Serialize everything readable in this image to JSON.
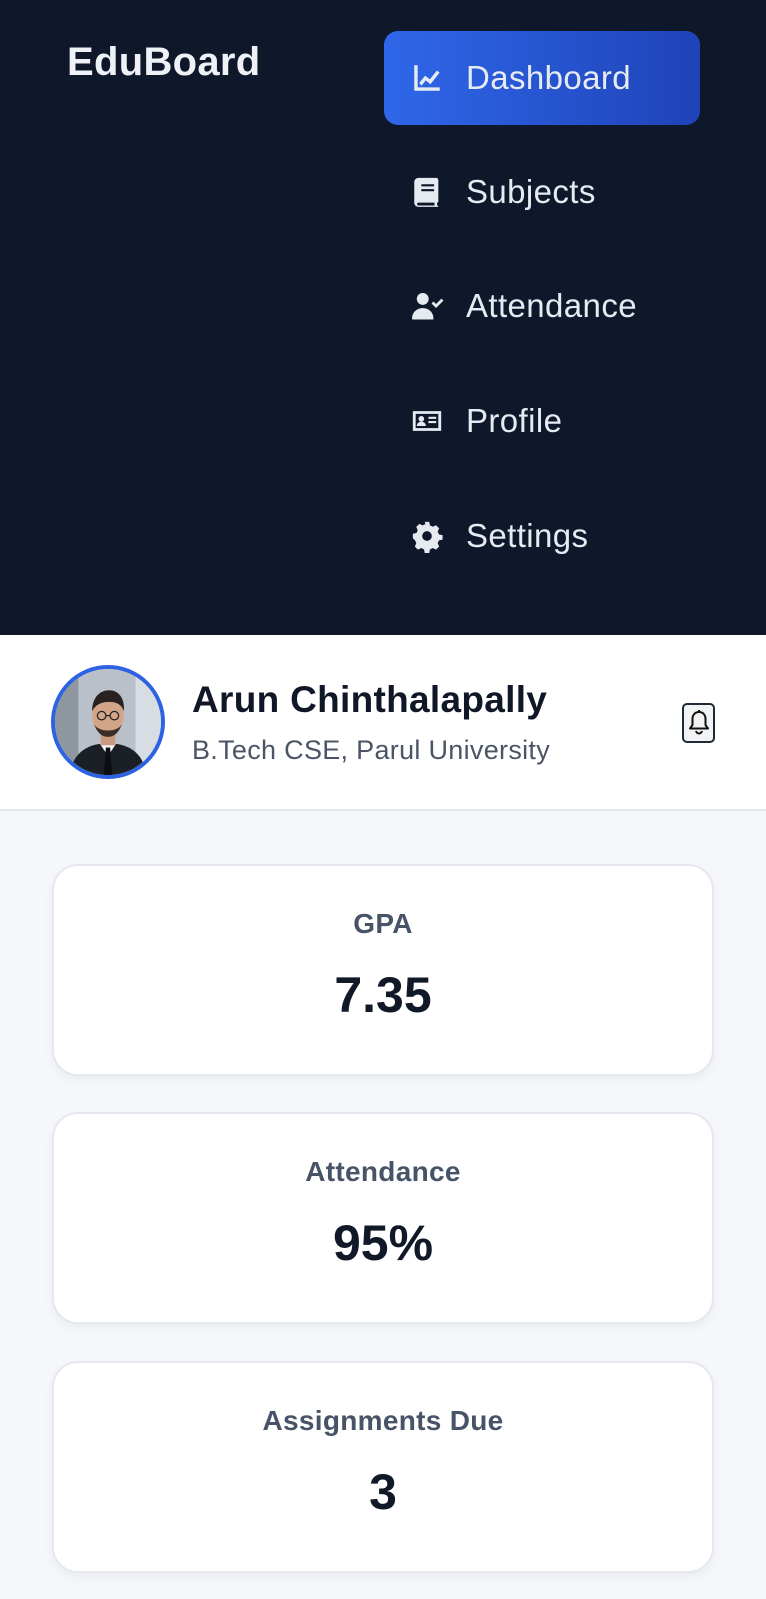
{
  "brand": "EduBoard",
  "nav": {
    "items": [
      {
        "label": "Dashboard",
        "icon": "chart-line-icon",
        "active": true
      },
      {
        "label": "Subjects",
        "icon": "book-icon",
        "active": false
      },
      {
        "label": "Attendance",
        "icon": "user-check-icon",
        "active": false
      },
      {
        "label": "Profile",
        "icon": "id-card-icon",
        "active": false
      },
      {
        "label": "Settings",
        "icon": "gear-icon",
        "active": false
      }
    ]
  },
  "user": {
    "name": "Arun Chinthalapally",
    "subtitle": "B.Tech CSE, Parul University"
  },
  "cards": [
    {
      "label": "GPA",
      "value": "7.35"
    },
    {
      "label": "Attendance",
      "value": "95%"
    },
    {
      "label": "Assignments Due",
      "value": "3"
    }
  ],
  "colors": {
    "nav_bg": "#0f172a",
    "accent": "#2f67ea",
    "page_bg": "#f5f7fb"
  }
}
